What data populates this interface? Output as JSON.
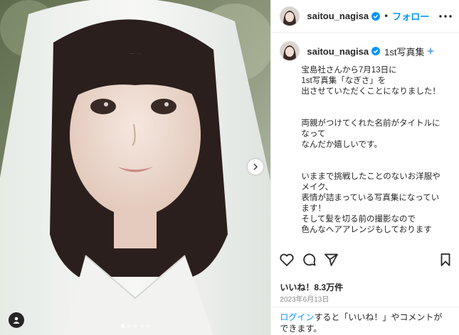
{
  "account": {
    "username": "saitou_nagisa",
    "verified": true,
    "follow_label": "フォロー",
    "separator": "•"
  },
  "caption": {
    "title": "1st写真集",
    "body": "宝島社さんから7月13日に\n1st写真集「なぎさ」を\n出させていただくことになりました！\n\n\n両親がつけてくれた名前がタイトルに\nなって\nなんだか嬉しいです。\n\n\nいままで挑戦したことのないお洋服や\nメイク、\n表情が詰まっている写真集になってい\nます！\nそして髪を切る前の撮影なので\n色んなヘアアレンジもしております"
  },
  "stats": {
    "likes": "いいね！8.3万件",
    "date": "2023年6月13日"
  },
  "login_prompt": {
    "link": "ログイン",
    "text": "すると「いいね！」やコメントができます。"
  },
  "carousel": {
    "slide_count": 5,
    "active_index": 0
  },
  "icons": {
    "verified": "verified-badge-icon",
    "more": "more-options-icon",
    "like": "heart-icon",
    "comment": "comment-icon",
    "share": "paper-plane-icon",
    "save": "bookmark-icon",
    "next": "chevron-right-icon",
    "tag": "user-tag-icon"
  },
  "colors": {
    "link_blue": "#0095f6",
    "text": "#262626",
    "muted": "#8e8e8e",
    "verified": "#0095f6"
  }
}
